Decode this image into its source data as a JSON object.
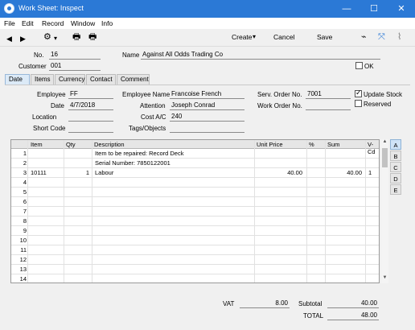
{
  "window": {
    "title": "Work Sheet: Inspect",
    "minimize": "—",
    "maximize": "☐",
    "close": "✕"
  },
  "menu": [
    "File",
    "Edit",
    "Record",
    "Window",
    "Info"
  ],
  "toolbar": {
    "prev": "◀",
    "next": "▶",
    "gear": "⚙",
    "gear_arrow": "▾",
    "print": "🖶",
    "print_preview": "🖶",
    "create_label": "Create",
    "create_arrow": "▾",
    "cancel_label": "Cancel",
    "save_label": "Save",
    "activity": "⌁",
    "expand": "⤧",
    "attach": "⌇"
  },
  "header": {
    "no_label": "No.",
    "no_value": "16",
    "name_label": "Name",
    "name_value": "Against All Odds Trading Co",
    "customer_label": "Customer",
    "customer_value": "001",
    "ok_label": "OK",
    "ok_checked": false
  },
  "tabs": [
    "Date",
    "Items",
    "Currency",
    "Contact",
    "Comment"
  ],
  "date_tab": {
    "employee_label": "Employee",
    "employee_value": "FF",
    "date_label": "Date",
    "date_value": "4/7/2018",
    "location_label": "Location",
    "location_value": "",
    "short_code_label": "Short Code",
    "short_code_value": "",
    "employee_name_label": "Employee Name",
    "employee_name_value": "Francoise French",
    "attention_label": "Attention",
    "attention_value": "Joseph Conrad",
    "cost_ac_label": "Cost A/C",
    "cost_ac_value": "240",
    "tags_label": "Tags/Objects",
    "tags_value": "",
    "serv_order_label": "Serv. Order No.",
    "serv_order_value": "7001",
    "work_order_label": "Work Order No.",
    "work_order_value": "",
    "update_stock_label": "Update Stock",
    "update_stock_checked": true,
    "reserved_label": "Reserved",
    "reserved_checked": false
  },
  "grid": {
    "columns": [
      "Item",
      "Qty",
      "Description",
      "Unit Price",
      "%",
      "Sum",
      "V-Cd"
    ],
    "rows": [
      {
        "n": "1",
        "item": "",
        "qty": "",
        "desc": "Item to be repaired: Record Deck",
        "price": "",
        "pct": "",
        "sum": "",
        "vcd": ""
      },
      {
        "n": "2",
        "item": "",
        "qty": "",
        "desc": "Serial Number: 7850122001",
        "price": "",
        "pct": "",
        "sum": "",
        "vcd": ""
      },
      {
        "n": "3",
        "item": "10111",
        "qty": "1",
        "desc": "Labour",
        "price": "40.00",
        "pct": "",
        "sum": "40.00",
        "vcd": "1"
      },
      {
        "n": "4",
        "item": "",
        "qty": "",
        "desc": "",
        "price": "",
        "pct": "",
        "sum": "",
        "vcd": ""
      },
      {
        "n": "5",
        "item": "",
        "qty": "",
        "desc": "",
        "price": "",
        "pct": "",
        "sum": "",
        "vcd": ""
      },
      {
        "n": "6",
        "item": "",
        "qty": "",
        "desc": "",
        "price": "",
        "pct": "",
        "sum": "",
        "vcd": ""
      },
      {
        "n": "7",
        "item": "",
        "qty": "",
        "desc": "",
        "price": "",
        "pct": "",
        "sum": "",
        "vcd": ""
      },
      {
        "n": "8",
        "item": "",
        "qty": "",
        "desc": "",
        "price": "",
        "pct": "",
        "sum": "",
        "vcd": ""
      },
      {
        "n": "9",
        "item": "",
        "qty": "",
        "desc": "",
        "price": "",
        "pct": "",
        "sum": "",
        "vcd": ""
      },
      {
        "n": "10",
        "item": "",
        "qty": "",
        "desc": "",
        "price": "",
        "pct": "",
        "sum": "",
        "vcd": ""
      },
      {
        "n": "11",
        "item": "",
        "qty": "",
        "desc": "",
        "price": "",
        "pct": "",
        "sum": "",
        "vcd": ""
      },
      {
        "n": "12",
        "item": "",
        "qty": "",
        "desc": "",
        "price": "",
        "pct": "",
        "sum": "",
        "vcd": ""
      },
      {
        "n": "13",
        "item": "",
        "qty": "",
        "desc": "",
        "price": "",
        "pct": "",
        "sum": "",
        "vcd": ""
      },
      {
        "n": "14",
        "item": "",
        "qty": "",
        "desc": "",
        "price": "",
        "pct": "",
        "sum": "",
        "vcd": ""
      }
    ],
    "flips": [
      "A",
      "B",
      "C",
      "D",
      "E"
    ],
    "scroll_up": "▲",
    "scroll_down": "▼"
  },
  "footer": {
    "vat_label": "VAT",
    "vat_value": "8.00",
    "subtotal_label": "Subtotal",
    "subtotal_value": "40.00",
    "total_label": "TOTAL",
    "total_value": "48.00"
  }
}
